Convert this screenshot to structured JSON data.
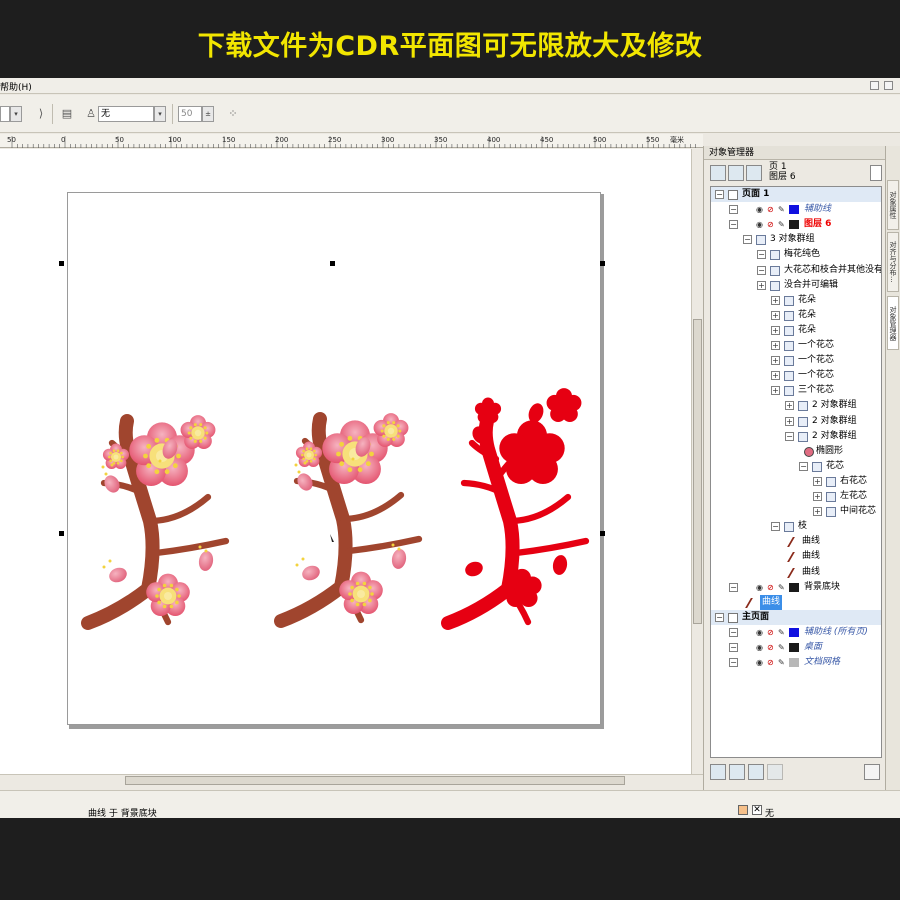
{
  "banner": {
    "text": "下载文件为CDR平面图可无限放大及修改"
  },
  "menubar": {
    "help": "帮助(H)"
  },
  "toolbar": {
    "outline_value": "无",
    "number_value": "50"
  },
  "ruler": {
    "labels": [
      "50",
      "0",
      "50",
      "100",
      "150",
      "200",
      "250",
      "300",
      "350",
      "400",
      "450",
      "500",
      "550"
    ],
    "unit": "毫米"
  },
  "status": {
    "text": "曲线 于 背景底块",
    "fill": "无"
  },
  "docker": {
    "title": "对象管理器",
    "page_label": "页 1",
    "layer_label": "图层 6"
  },
  "tree": [
    {
      "label": "页面 1",
      "indent": 0,
      "type": "page"
    },
    {
      "label": "辅助线",
      "indent": 1,
      "type": "layer",
      "color": "#1010e0",
      "italic": true
    },
    {
      "label": "图层 6",
      "indent": 1,
      "type": "layer",
      "color": "#1a1a1a",
      "red": true
    },
    {
      "label": "3 对象群组",
      "indent": 2,
      "type": "group"
    },
    {
      "label": "梅花纯色",
      "indent": 3,
      "type": "group"
    },
    {
      "label": "大花芯和枝合并其他没有",
      "indent": 3,
      "type": "group"
    },
    {
      "label": "没合并可编辑",
      "indent": 3,
      "type": "group"
    },
    {
      "label": "花朵",
      "indent": 4,
      "type": "group"
    },
    {
      "label": "花朵",
      "indent": 4,
      "type": "group"
    },
    {
      "label": "花朵",
      "indent": 4,
      "type": "group"
    },
    {
      "label": "一个花芯",
      "indent": 4,
      "type": "group"
    },
    {
      "label": "一个花芯",
      "indent": 4,
      "type": "group"
    },
    {
      "label": "一个花芯",
      "indent": 4,
      "type": "group"
    },
    {
      "label": "三个花芯",
      "indent": 4,
      "type": "group"
    },
    {
      "label": "2 对象群组",
      "indent": 5,
      "type": "group"
    },
    {
      "label": "2 对象群组",
      "indent": 5,
      "type": "group"
    },
    {
      "label": "2 对象群组",
      "indent": 5,
      "type": "group"
    },
    {
      "label": "椭圆形",
      "indent": 6,
      "type": "ellipse"
    },
    {
      "label": "花芯",
      "indent": 6,
      "type": "group"
    },
    {
      "label": "右花芯",
      "indent": 7,
      "type": "group"
    },
    {
      "label": "左花芯",
      "indent": 7,
      "type": "group"
    },
    {
      "label": "中间花芯",
      "indent": 7,
      "type": "group"
    },
    {
      "label": "枝",
      "indent": 4,
      "type": "group"
    },
    {
      "label": "曲线",
      "indent": 5,
      "type": "curve"
    },
    {
      "label": "曲线",
      "indent": 5,
      "type": "curve"
    },
    {
      "label": "曲线",
      "indent": 5,
      "type": "curve"
    },
    {
      "label": "背景底块",
      "indent": 1,
      "type": "layer",
      "color": "#1a1a1a"
    },
    {
      "label": "曲线",
      "indent": 2,
      "type": "curve",
      "selected": true
    },
    {
      "label": "主页面",
      "indent": 0,
      "type": "page"
    },
    {
      "label": "辅助线 (所有页)",
      "indent": 1,
      "type": "layer",
      "color": "#1010e0",
      "italic": true
    },
    {
      "label": "桌面",
      "indent": 1,
      "type": "layer",
      "color": "#1a1a1a",
      "italic": true
    },
    {
      "label": "文档网格",
      "indent": 1,
      "type": "layer",
      "color": "#b8b8b8",
      "italic": true
    }
  ],
  "side_tabs": [
    "对象属性",
    "对齐与分布...",
    "对象管理器"
  ],
  "colors": {
    "blossom": "#e7607a",
    "blossom_light": "#f0a0b0",
    "center": "#f7e07a",
    "branch": "#a0452e",
    "solid_red": "#e60012"
  }
}
